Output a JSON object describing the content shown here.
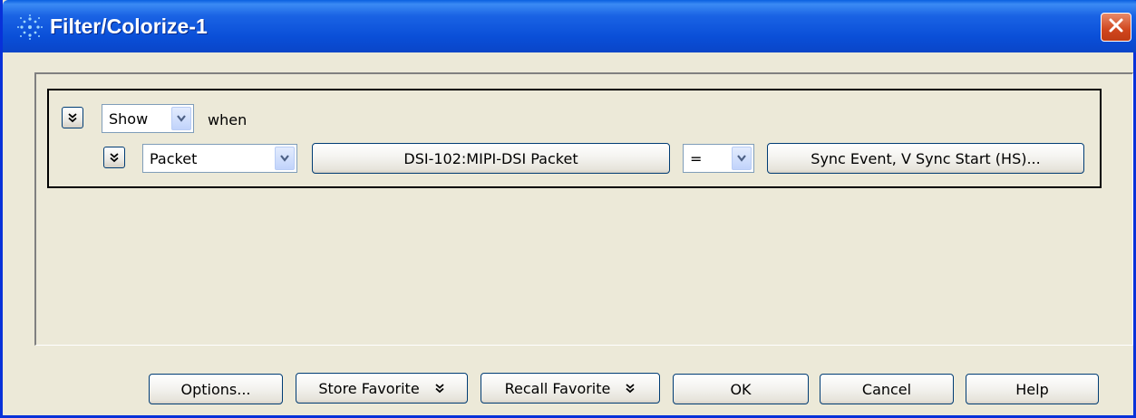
{
  "window": {
    "title": "Filter/Colorize-1"
  },
  "condition": {
    "mode_select": "Show",
    "when_label": "when",
    "field_select": "Packet",
    "packet_button": "DSI-102:MIPI-DSI Packet",
    "operator_select": "=",
    "value_button": "Sync Event, V Sync Start (HS)..."
  },
  "buttons": {
    "options": "Options...",
    "store_favorite": "Store Favorite",
    "recall_favorite": "Recall Favorite",
    "ok": "OK",
    "cancel": "Cancel",
    "help": "Help"
  },
  "colors": {
    "titlebar": "#0a4fd8",
    "dialog_bg": "#ece9d8",
    "close": "#d0461d"
  },
  "icons": {
    "app": "sparkle-icon",
    "close": "close-icon",
    "expand": "double-chevron-down-icon",
    "dropdown": "chevron-down-icon"
  }
}
